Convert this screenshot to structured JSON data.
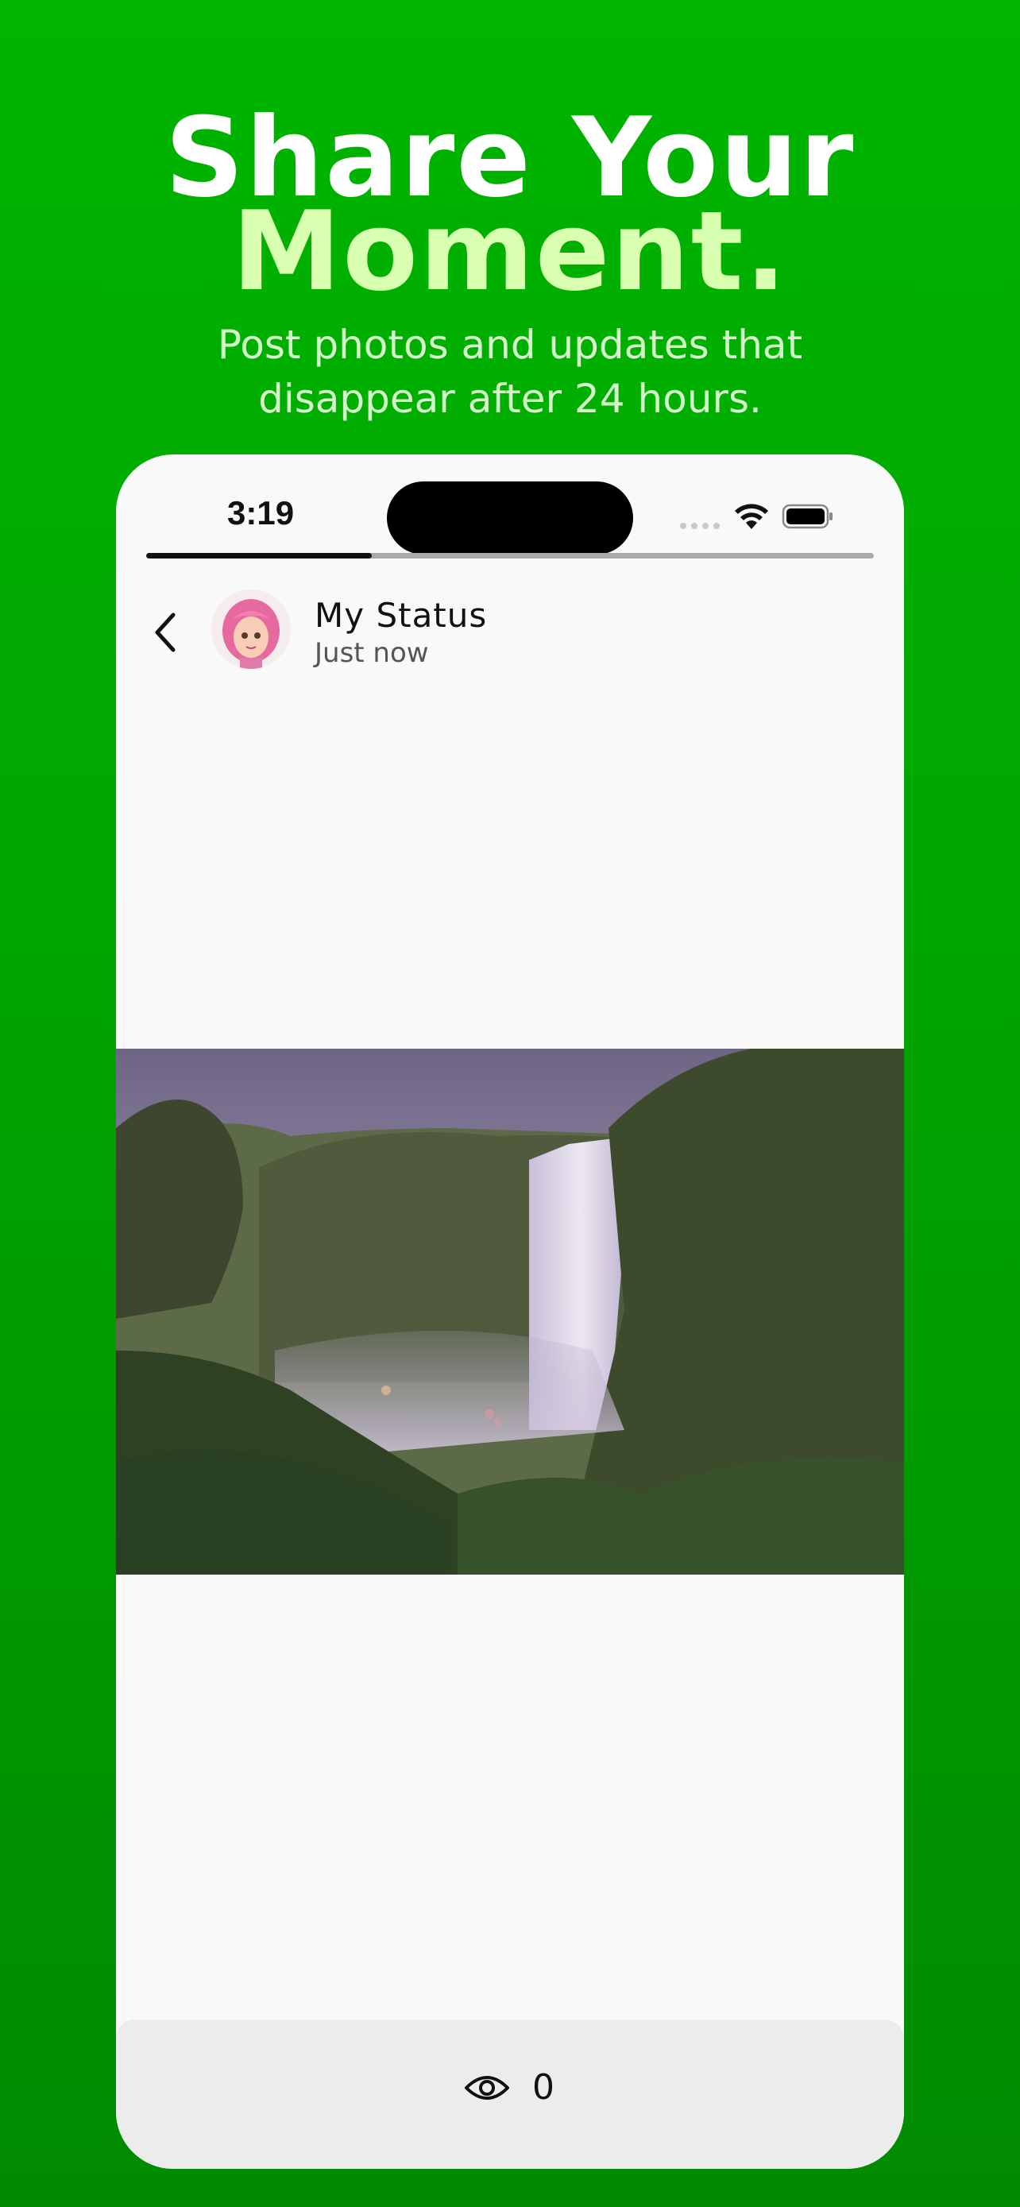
{
  "promo": {
    "headline_line1": "Share Your",
    "headline_line2": "Moment.",
    "subhead_line1": "Post photos and updates that",
    "subhead_line2": "disappear after 24 hours."
  },
  "status_bar": {
    "time": "3:19",
    "icons": [
      "cellular-signal-icon",
      "wifi-icon",
      "battery-icon"
    ]
  },
  "story": {
    "progress": 0.31,
    "title": "My Status",
    "timestamp": "Just now",
    "avatar_icon": "avatar",
    "back_icon": "back-chevron-icon"
  },
  "footer": {
    "view_icon": "eye-icon",
    "view_count": "0"
  },
  "colors": {
    "background_top": "#00b400",
    "background_bottom": "#008a00",
    "headline_accent": "#d9ffb0",
    "phone_bg": "#f9f9f9",
    "footer_bg": "#ececec"
  }
}
